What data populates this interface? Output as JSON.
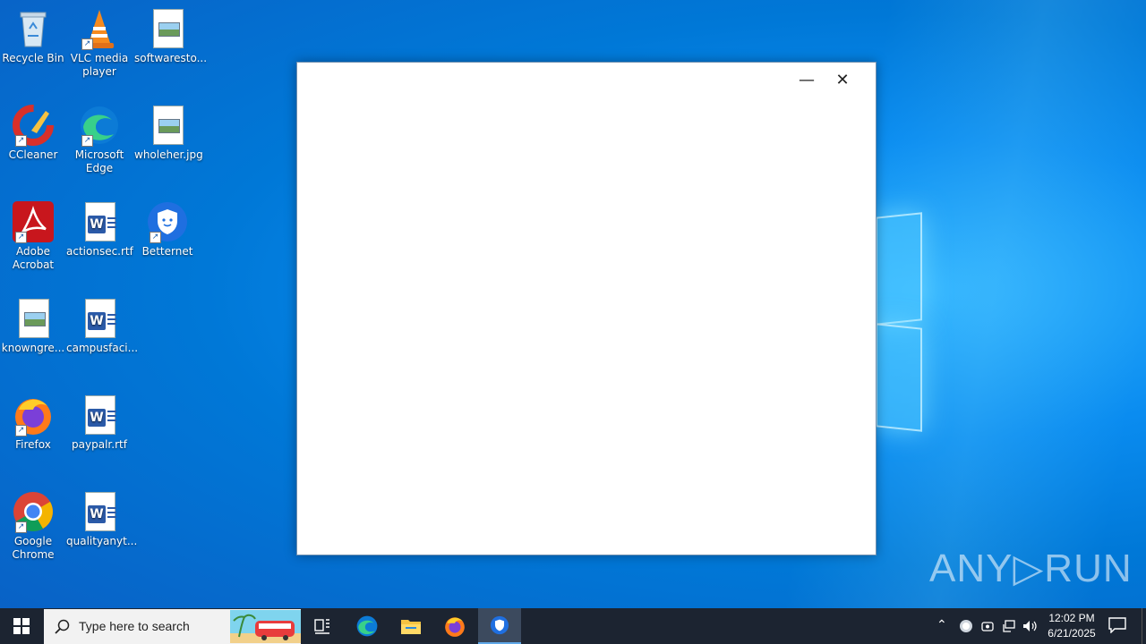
{
  "desktop": {
    "icons": [
      {
        "label": "Recycle Bin"
      },
      {
        "label": "VLC media player"
      },
      {
        "label": "softwaresto..."
      },
      {
        "label": "CCleaner"
      },
      {
        "label": "Microsoft Edge"
      },
      {
        "label": "wholeher.jpg"
      },
      {
        "label": "Adobe Acrobat"
      },
      {
        "label": "actionsec.rtf"
      },
      {
        "label": "Betternet"
      },
      {
        "label": "knowngre..."
      },
      {
        "label": "campusfaci..."
      },
      {
        "label": "Firefox"
      },
      {
        "label": "paypalr.rtf"
      },
      {
        "label": "Google Chrome"
      },
      {
        "label": "qualityanyt..."
      }
    ]
  },
  "window": {
    "minimize_glyph": "—",
    "close_glyph": "✕"
  },
  "watermark": "ANY▷RUN",
  "taskbar": {
    "search_placeholder": "Type here to search",
    "clock_time": "12:02 PM",
    "clock_date": "6/21/2025",
    "active_app": "Betternet"
  },
  "colors": {
    "desktop_bg": "#0078d7",
    "taskbar_bg": "#1c2431",
    "active_indicator": "#5fa8e8"
  }
}
